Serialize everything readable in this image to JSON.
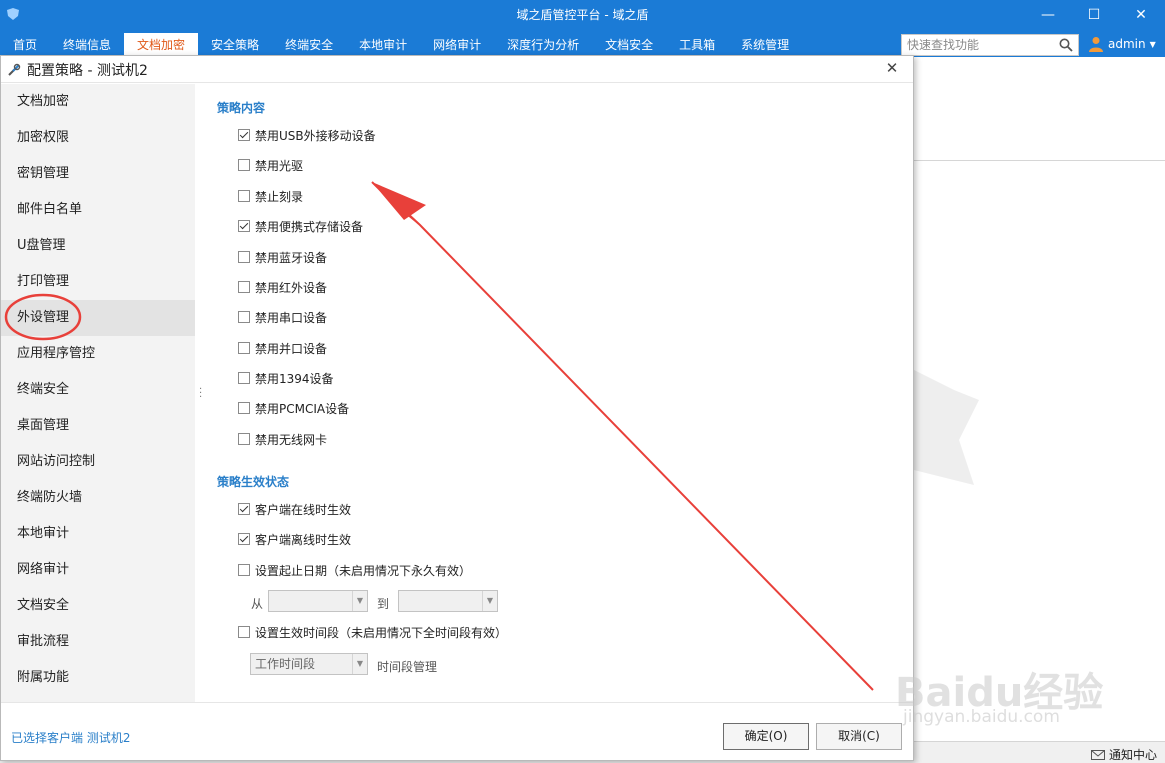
{
  "window": {
    "title": "域之盾管控平台 - 域之盾",
    "minimize": "—",
    "maximize": "☐",
    "close": "✕"
  },
  "nav": {
    "items": [
      {
        "label": "首页"
      },
      {
        "label": "终端信息"
      },
      {
        "label": "文档加密",
        "active": true
      },
      {
        "label": "安全策略"
      },
      {
        "label": "终端安全"
      },
      {
        "label": "本地审计"
      },
      {
        "label": "网络审计"
      },
      {
        "label": "深度行为分析"
      },
      {
        "label": "文档安全"
      },
      {
        "label": "工具箱"
      },
      {
        "label": "系统管理"
      }
    ],
    "search_placeholder": "快速查找功能",
    "user": "admin",
    "accent": "#1b7bd6",
    "active_color": "#e05a1a"
  },
  "dialog": {
    "title": "配置策略 - 测试机2",
    "close": "✕",
    "sidebar": [
      {
        "label": "文档加密"
      },
      {
        "label": "加密权限"
      },
      {
        "label": "密钥管理"
      },
      {
        "label": "邮件白名单"
      },
      {
        "label": "U盘管理"
      },
      {
        "label": "打印管理"
      },
      {
        "label": "外设管理",
        "active": true
      },
      {
        "label": "应用程序管控"
      },
      {
        "label": "终端安全"
      },
      {
        "label": "桌面管理"
      },
      {
        "label": "网站访问控制"
      },
      {
        "label": "终端防火墙"
      },
      {
        "label": "本地审计"
      },
      {
        "label": "网络审计"
      },
      {
        "label": "文档安全"
      },
      {
        "label": "审批流程"
      },
      {
        "label": "附属功能"
      }
    ],
    "policy_content": {
      "title": "策略内容",
      "options": [
        {
          "label": "禁用USB外接移动设备",
          "checked": true
        },
        {
          "label": "禁用光驱",
          "checked": false
        },
        {
          "label": "禁止刻录",
          "checked": false
        },
        {
          "label": "禁用便携式存储设备",
          "checked": true
        },
        {
          "label": "禁用蓝牙设备",
          "checked": false
        },
        {
          "label": "禁用红外设备",
          "checked": false
        },
        {
          "label": "禁用串口设备",
          "checked": false
        },
        {
          "label": "禁用并口设备",
          "checked": false
        },
        {
          "label": "禁用1394设备",
          "checked": false
        },
        {
          "label": "禁用PCMCIA设备",
          "checked": false
        },
        {
          "label": "禁用无线网卡",
          "checked": false
        }
      ]
    },
    "policy_status": {
      "title": "策略生效状态",
      "online": {
        "label": "客户端在线时生效",
        "checked": true
      },
      "offline": {
        "label": "客户端离线时生效",
        "checked": true
      },
      "date_range": {
        "label": "设置起止日期（未启用情况下永久有效）",
        "checked": false
      },
      "from_label": "从",
      "to_label": "到",
      "from_value": "",
      "to_value": "",
      "time_period": {
        "label": "设置生效时间段（未启用情况下全时间段有效）",
        "checked": false
      },
      "time_select": "工作时间段",
      "time_manage": "时间段管理"
    },
    "footer": {
      "selected_client": "已选择客户端 测试机2",
      "ok": "确定(O)",
      "cancel": "取消(C)"
    }
  },
  "statusbar": {
    "notification": "通知中心"
  },
  "watermark": {
    "brand": "Baidu经验",
    "url": "jingyan.baidu.com"
  }
}
